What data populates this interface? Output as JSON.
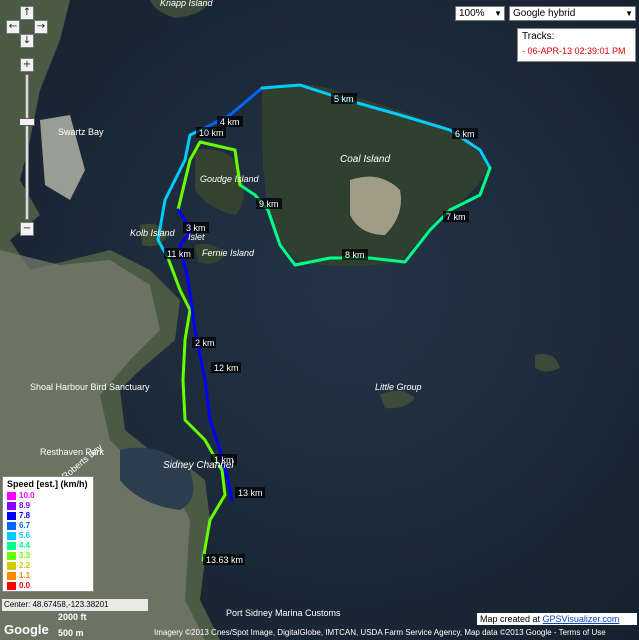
{
  "controls": {
    "zoom_select": "100%",
    "map_type_select": "Google hybrid",
    "pan_up": "↑",
    "pan_down": "↓",
    "pan_left": "←",
    "pan_right": "→",
    "zoom_in": "+",
    "zoom_out": "−"
  },
  "tracks": {
    "title": "Tracks:",
    "items": [
      "- 06-APR-13 02:39:01 PM"
    ]
  },
  "legend": {
    "title": "Speed [est.] (km/h)",
    "entries": [
      {
        "value": "10.0",
        "color": "#ff00ff"
      },
      {
        "value": "8.9",
        "color": "#8800ff"
      },
      {
        "value": "7.8",
        "color": "#0000ff"
      },
      {
        "value": "6.7",
        "color": "#0066ff"
      },
      {
        "value": "5.6",
        "color": "#00ccff"
      },
      {
        "value": "4.4",
        "color": "#00ff88"
      },
      {
        "value": "3.3",
        "color": "#66ff00"
      },
      {
        "value": "2.2",
        "color": "#cccc00"
      },
      {
        "value": "1.1",
        "color": "#ff8800"
      },
      {
        "value": "0.0",
        "color": "#ff0000"
      }
    ]
  },
  "distance_labels": [
    "1 km",
    "2 km",
    "3 km",
    "4 km",
    "5 km",
    "6 km",
    "7 km",
    "8 km",
    "9 km",
    "10 km",
    "11 km",
    "12 km",
    "13 km",
    "13.63 km"
  ],
  "place_labels": {
    "coal_island": "Coal Island",
    "gouge_island": "Goudge Island",
    "kolb_island": "Kolb Island",
    "fernie_island": "Fernie Island",
    "islet": "Islet",
    "sidney_channel": "Sidney Channel",
    "little_group": "Little Group",
    "shoal_harbour": "Shoal Harbour Bird Sanctuary",
    "resthaven_park": "Resthaven Park",
    "swartz_bay": "Swartz Bay",
    "port_sidney": "Port Sidney Marina Customs",
    "knapp_island": "Knapp Island",
    "roberts_bay": "Roberts Bay"
  },
  "center_readout": "Center: 48.67458,-123.38201",
  "scale": {
    "feet": "2000 ft",
    "meters": "500 m"
  },
  "copyright": "Imagery ©2013 Cnes/Spot Image, DigitalGlobe, IMTCAN, USDA Farm Service Agency, Map data ©2013 Google - Terms of Use",
  "credit": {
    "prefix": "Map created at ",
    "link": "GPSVisualizer.com"
  },
  "google_logo": "Google"
}
